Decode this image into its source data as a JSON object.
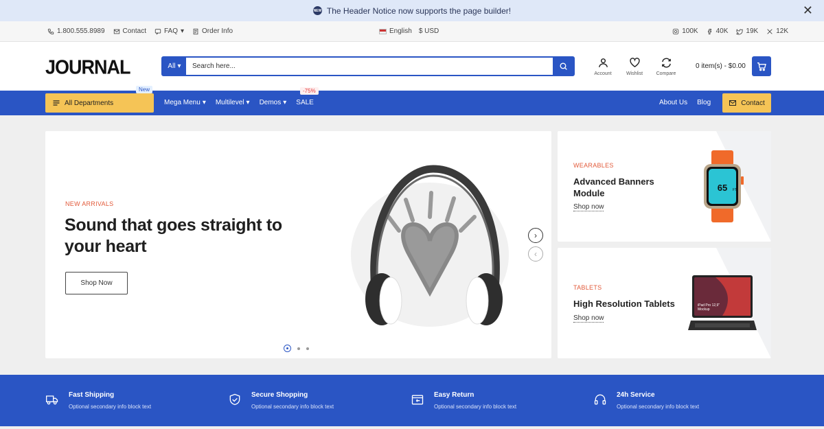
{
  "notice": {
    "badge": "NEW",
    "text": "The Header Notice now supports the page builder!"
  },
  "topbar": {
    "phone": "1.800.555.8989",
    "contact": "Contact",
    "faq": "FAQ",
    "order_info": "Order Info",
    "language": "English",
    "currency": "$ USD",
    "social": {
      "instagram": "100K",
      "facebook": "40K",
      "twitter": "19K",
      "x": "12K"
    }
  },
  "header": {
    "logo": "JOURNAL",
    "search": {
      "category": "All",
      "placeholder": "Search here..."
    },
    "account": "Account",
    "wishlist": "Wishlist",
    "compare": "Compare",
    "cart": "0 item(s) - $0.00"
  },
  "nav": {
    "departments": "All Departments",
    "new_tag": "New",
    "items": [
      "Mega Menu",
      "Multilevel",
      "Demos",
      "SALE"
    ],
    "sale_tag": "-75%",
    "right": [
      "About Us",
      "Blog"
    ],
    "contact": "Contact"
  },
  "hero": {
    "eyebrow": "NEW ARRIVALS",
    "headline": "Sound that goes straight to your heart",
    "button": "Shop Now",
    "slides": 3,
    "active_slide": 1
  },
  "banners": [
    {
      "category": "WEARABLES",
      "title": "Advanced Banners Module",
      "link": "Shop now"
    },
    {
      "category": "TABLETS",
      "title": "High Resolution Tablets",
      "link": "Shop now"
    }
  ],
  "watch_screen": {
    "value": "65",
    "unit": "FT"
  },
  "tablet_screen": {
    "line1": "iPad Pro 12,9\"",
    "line2": "Mockup"
  },
  "info": [
    {
      "title": "Fast Shipping",
      "subtitle": "Optional secondary info block text"
    },
    {
      "title": "Secure Shopping",
      "subtitle": "Optional secondary info block text"
    },
    {
      "title": "Easy Return",
      "subtitle": "Optional secondary info block text"
    },
    {
      "title": "24h Service",
      "subtitle": "Optional secondary info block text"
    }
  ],
  "colors": {
    "primary": "#2a55c4",
    "accent": "#f5c456",
    "eyebrow": "#e25a3a",
    "notice_bg": "#dfe8f8"
  }
}
